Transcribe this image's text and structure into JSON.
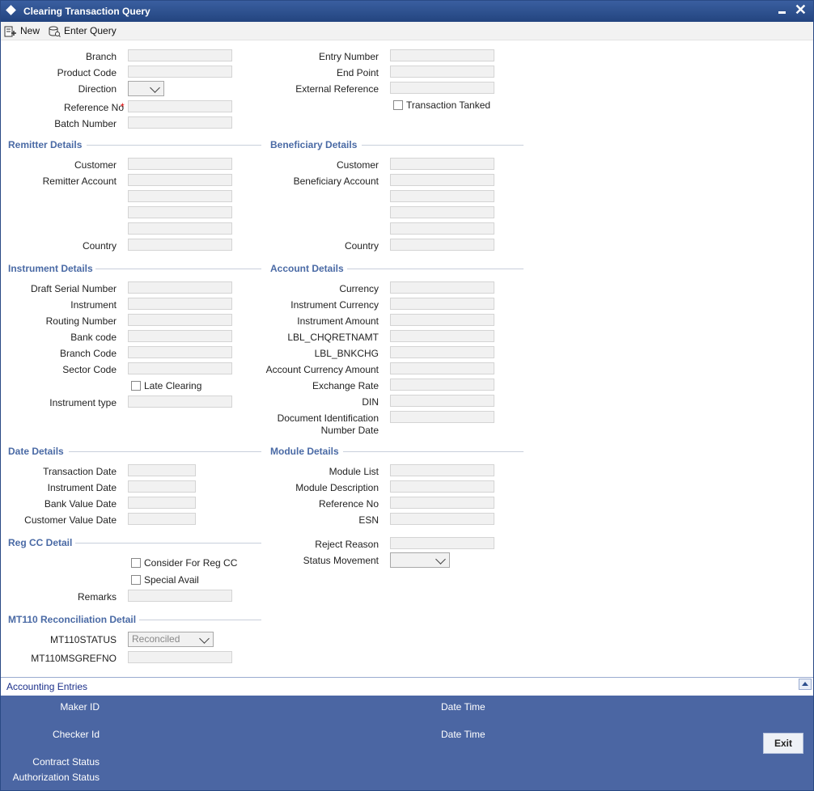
{
  "window": {
    "title": "Clearing Transaction Query"
  },
  "toolbar": {
    "new_label": "New",
    "enter_query_label": "Enter Query"
  },
  "header": {
    "branch": "Branch",
    "product_code": "Product Code",
    "direction": "Direction",
    "reference_no": "Reference No",
    "batch_number": "Batch Number",
    "entry_number": "Entry Number",
    "end_point": "End Point",
    "external_reference": "External Reference",
    "transaction_tanked": "Transaction Tanked"
  },
  "remitter": {
    "title": "Remitter Details",
    "customer": "Customer",
    "account": "Remitter Account",
    "country": "Country"
  },
  "beneficiary": {
    "title": "Beneficiary Details",
    "customer": "Customer",
    "account": "Beneficiary Account",
    "country": "Country"
  },
  "instrument": {
    "title": "Instrument Details",
    "draft_serial": "Draft Serial Number",
    "instrument": "Instrument",
    "routing": "Routing Number",
    "bank_code": "Bank code",
    "branch_code": "Branch Code",
    "sector_code": "Sector Code",
    "late_clearing": "Late Clearing",
    "instrument_type": "Instrument type"
  },
  "account": {
    "title": "Account Details",
    "currency": "Currency",
    "instrument_currency": "Instrument Currency",
    "instrument_amount": "Instrument Amount",
    "chqretnamt": "LBL_CHQRETNAMT",
    "bnkchg": "LBL_BNKCHG",
    "account_currency_amount": "Account Currency Amount",
    "exchange_rate": "Exchange Rate",
    "din": "DIN",
    "doc_id_1": "Document Identification",
    "doc_id_2": "Number Date"
  },
  "date": {
    "title": "Date Details",
    "transaction_date": "Transaction Date",
    "instrument_date": "Instrument Date",
    "bank_value_date": "Bank Value Date",
    "customer_value_date": "Customer Value Date"
  },
  "module": {
    "title": "Module Details",
    "module_list": "Module List",
    "module_description": "Module Description",
    "reference_no": "Reference No",
    "esn": "ESN",
    "reject_reason": "Reject Reason",
    "status_movement": "Status Movement"
  },
  "regcc": {
    "title": "Reg CC Detail",
    "consider": "Consider For Reg CC",
    "special_avail": "Special Avail",
    "remarks": "Remarks"
  },
  "mt110": {
    "title": "MT110 Reconciliation Detail",
    "status": "MT110STATUS",
    "status_value": "Reconciled",
    "msgrefno": "MT110MSGREFNO"
  },
  "bottom": {
    "accounting_entries": "Accounting Entries"
  },
  "footer": {
    "maker_id": "Maker ID",
    "checker_id": "Checker Id",
    "date_time_1": "Date Time",
    "date_time_2": "Date Time",
    "contract_status": "Contract Status",
    "authorization_status": "Authorization Status",
    "exit": "Exit"
  },
  "colors": {
    "title_bar": "#2d4f8d",
    "section_title": "#4a6aa5",
    "footer": "#4b66a3"
  }
}
